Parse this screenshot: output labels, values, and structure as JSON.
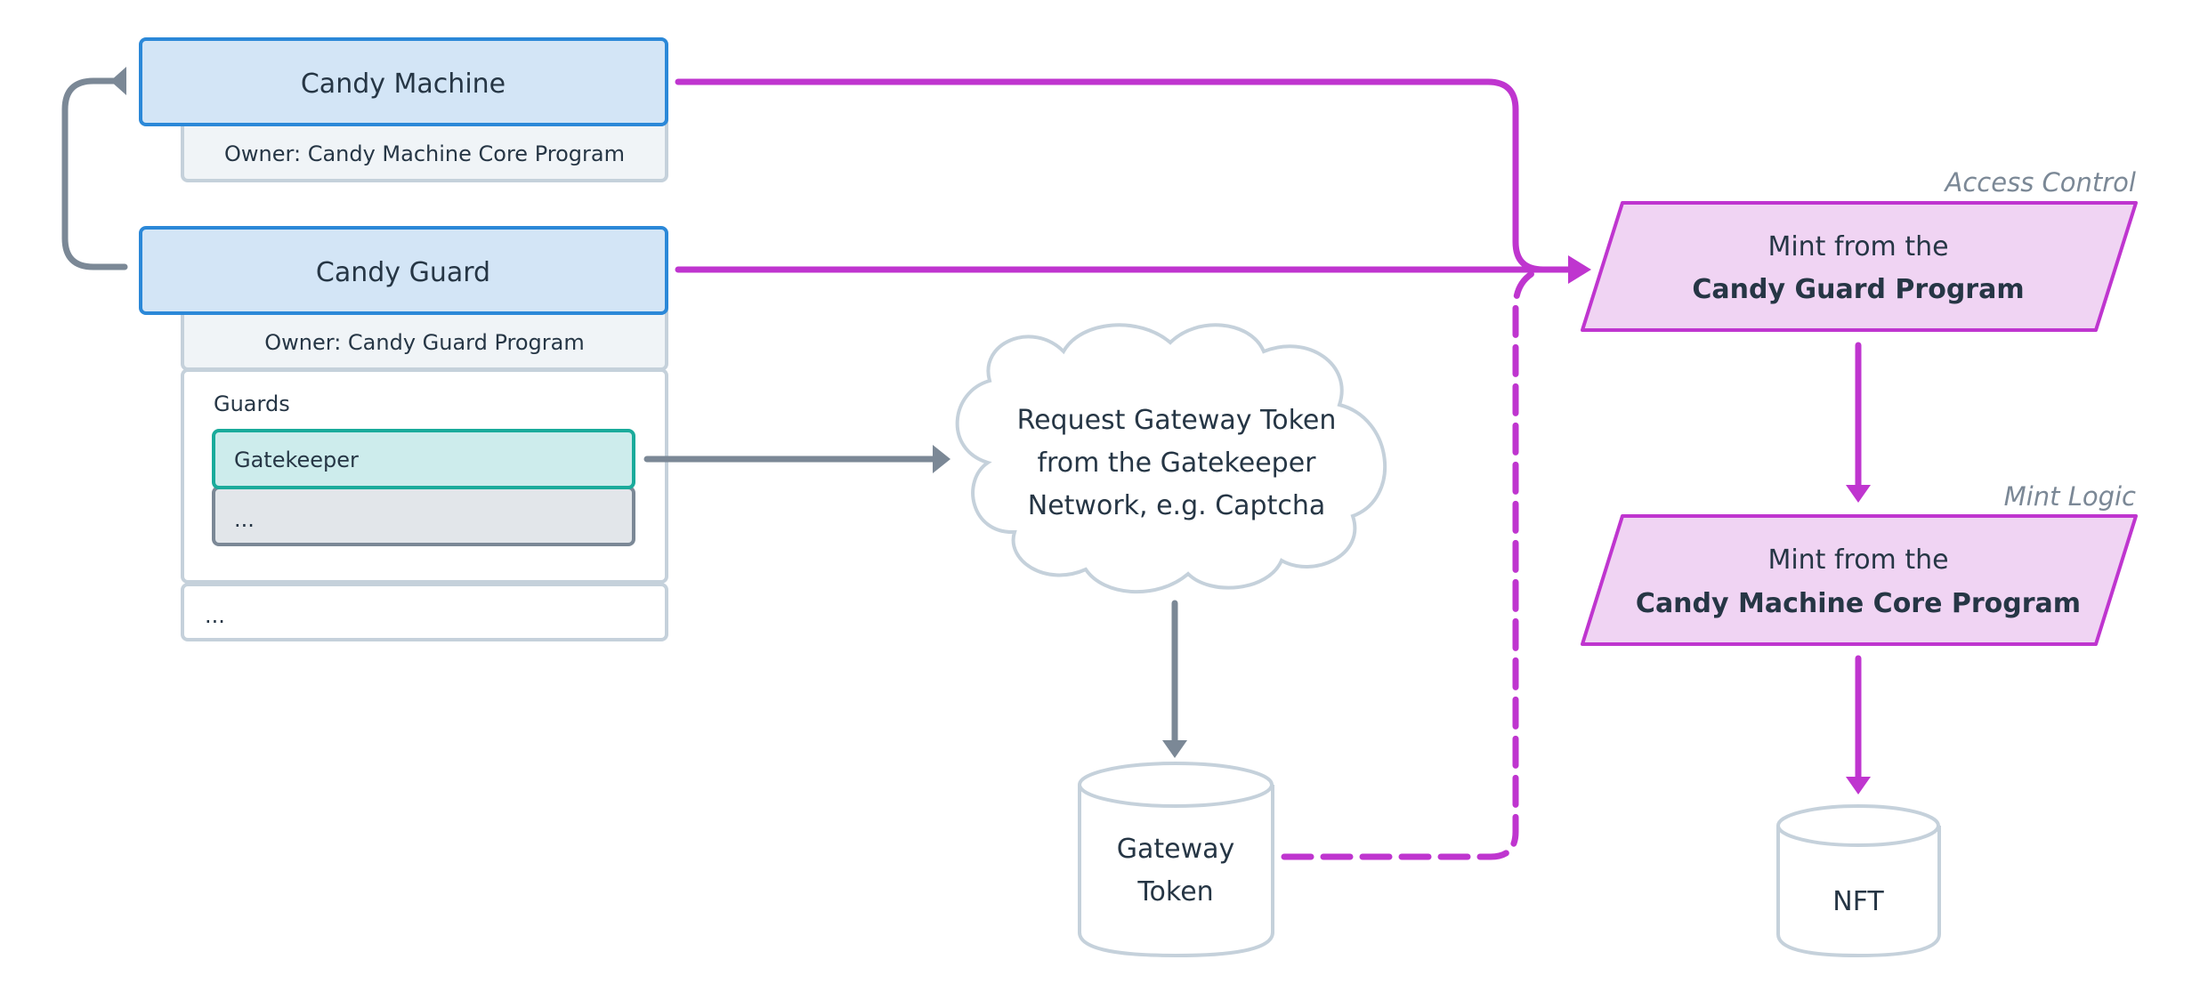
{
  "diagram": {
    "accounts": {
      "candy_machine": {
        "title": "Candy Machine",
        "owner": "Owner: Candy Machine Core Program"
      },
      "candy_guard": {
        "title": "Candy Guard",
        "owner": "Owner: Candy Guard Program",
        "guards_label": "Guards",
        "guards": [
          "Gatekeeper",
          "..."
        ],
        "more": "..."
      }
    },
    "gatekeeper_request": {
      "lines": [
        "Request Gateway Token",
        "from the Gatekeeper",
        "Network, e.g. Captcha"
      ]
    },
    "gateway_token": {
      "lines": [
        "Gateway",
        "Token"
      ]
    },
    "steps": [
      {
        "label": "Access Control",
        "line1": "Mint from the",
        "line2": "Candy Guard Program"
      },
      {
        "label": "Mint Logic",
        "line1": "Mint from the",
        "line2": "Candy Machine Core Program"
      }
    ],
    "output": {
      "label": "NFT"
    },
    "colors": {
      "account_fill": "#d3e5f6",
      "account_border": "#2b88d8",
      "flow": "#bf35cf",
      "step_fill": "#f0d4f3",
      "gatekeeper_fill": "#cdecec",
      "gatekeeper_border": "#1aab9b",
      "connector_gray": "#7b8896",
      "text": "#263645"
    },
    "edges": [
      {
        "from": "Candy Guard",
        "to": "Candy Machine",
        "style": "solid-gray"
      },
      {
        "from": "Candy Machine",
        "to": "Mint from the Candy Guard Program",
        "style": "solid-magenta"
      },
      {
        "from": "Candy Guard",
        "to": "Mint from the Candy Guard Program",
        "style": "solid-magenta"
      },
      {
        "from": "Gatekeeper",
        "to": "Request Gateway Token",
        "style": "solid-gray"
      },
      {
        "from": "Request Gateway Token",
        "to": "Gateway Token",
        "style": "solid-gray"
      },
      {
        "from": "Gateway Token",
        "to": "Mint from the Candy Guard Program",
        "style": "dashed-magenta"
      },
      {
        "from": "Mint from the Candy Guard Program",
        "to": "Mint from the Candy Machine Core Program",
        "style": "solid-magenta"
      },
      {
        "from": "Mint from the Candy Machine Core Program",
        "to": "NFT",
        "style": "solid-magenta"
      }
    ]
  }
}
